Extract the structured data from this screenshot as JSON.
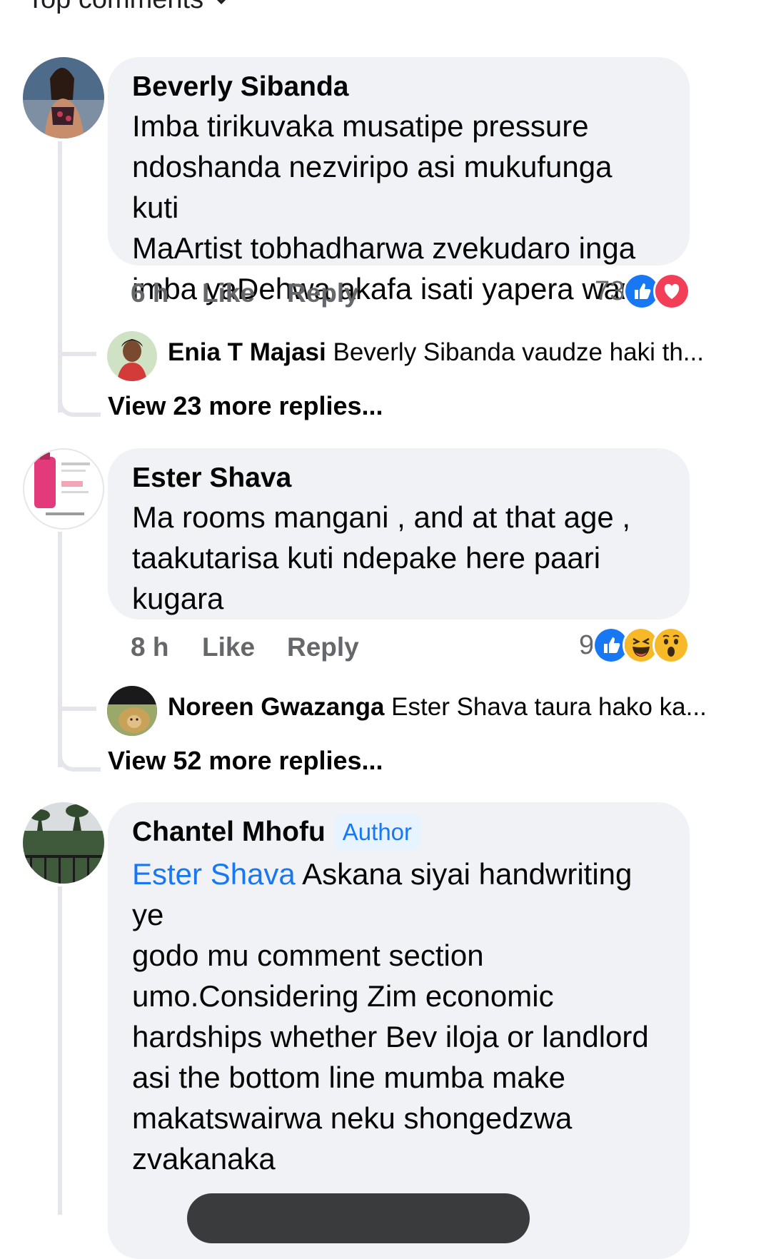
{
  "header": {
    "title": "Top comments"
  },
  "comments": [
    {
      "author": "Beverly Sibanda",
      "lines": [
        "Imba tirikuvaka musatipe pressure",
        "ndoshanda nezviripo asi mukufunga kuti",
        "MaArtist tobhadharwa zvekudaro inga",
        "imba yaDehwa akafa isati yapera wani"
      ],
      "time": "6 h",
      "like": "Like",
      "reply": "Reply",
      "reaction_count": "73",
      "reactions": [
        "like-icon",
        "love-icon"
      ],
      "top_reply": {
        "author": "Enia T Majasi",
        "text": "Beverly Sibanda vaudze haki th..."
      },
      "view_more": "View 23 more replies..."
    },
    {
      "author": "Ester Shava",
      "lines": [
        "Ma rooms mangani , and at that age ,",
        "taakutarisa kuti ndepake here paari",
        "kugara"
      ],
      "time": "8 h",
      "like": "Like",
      "reply": "Reply",
      "reaction_count": "9",
      "reactions": [
        "like-icon",
        "haha-icon",
        "wow-icon"
      ],
      "top_reply": {
        "author": "Noreen Gwazanga",
        "text": "Ester Shava taura hako ka..."
      },
      "view_more": "View 52 more replies..."
    },
    {
      "author": "Chantel Mhofu",
      "badge": "Author",
      "mention": "Ester Shava",
      "first_line_rest": " Askana siyai handwriting ye",
      "lines": [
        "godo mu comment section",
        "umo.Considering Zim economic",
        "hardships whether Bev iloja or landlord",
        "asi the bottom line mumba make",
        "makatswairwa neku shongedzwa",
        "zvakanaka"
      ]
    }
  ],
  "colors": {
    "accent": "#1877f2",
    "bubble": "#f0f2f5",
    "meta": "#65676b",
    "line": "#e4e6eb"
  }
}
